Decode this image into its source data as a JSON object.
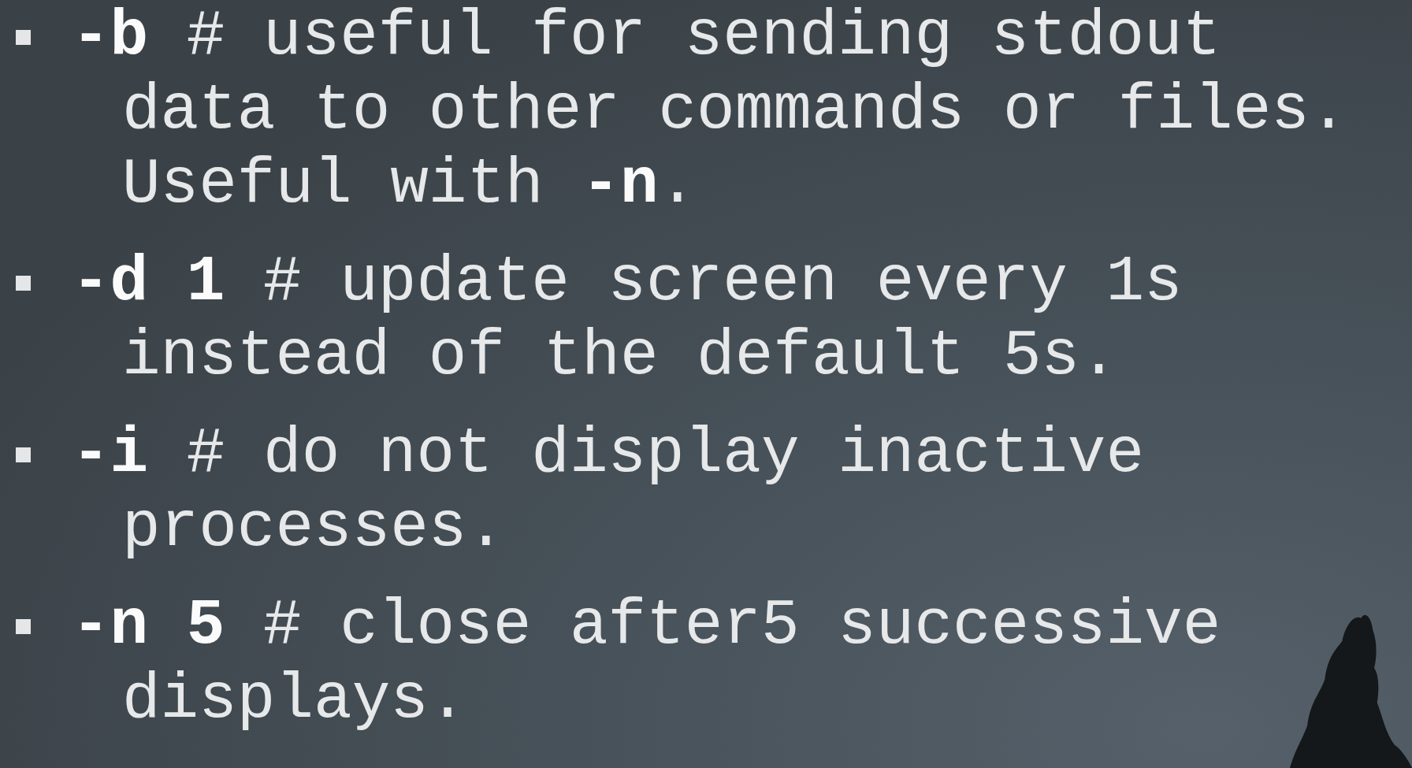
{
  "items": [
    {
      "text": "**-b** # useful for sending stdout data to other commands or files. Useful with **-n**."
    },
    {
      "text": "**-d 1** # update screen every 1s instead of the default 5s."
    },
    {
      "text": "**-i** # do not display inactive processes."
    },
    {
      "text": "**-n 5** # close after5 successive displays."
    }
  ]
}
